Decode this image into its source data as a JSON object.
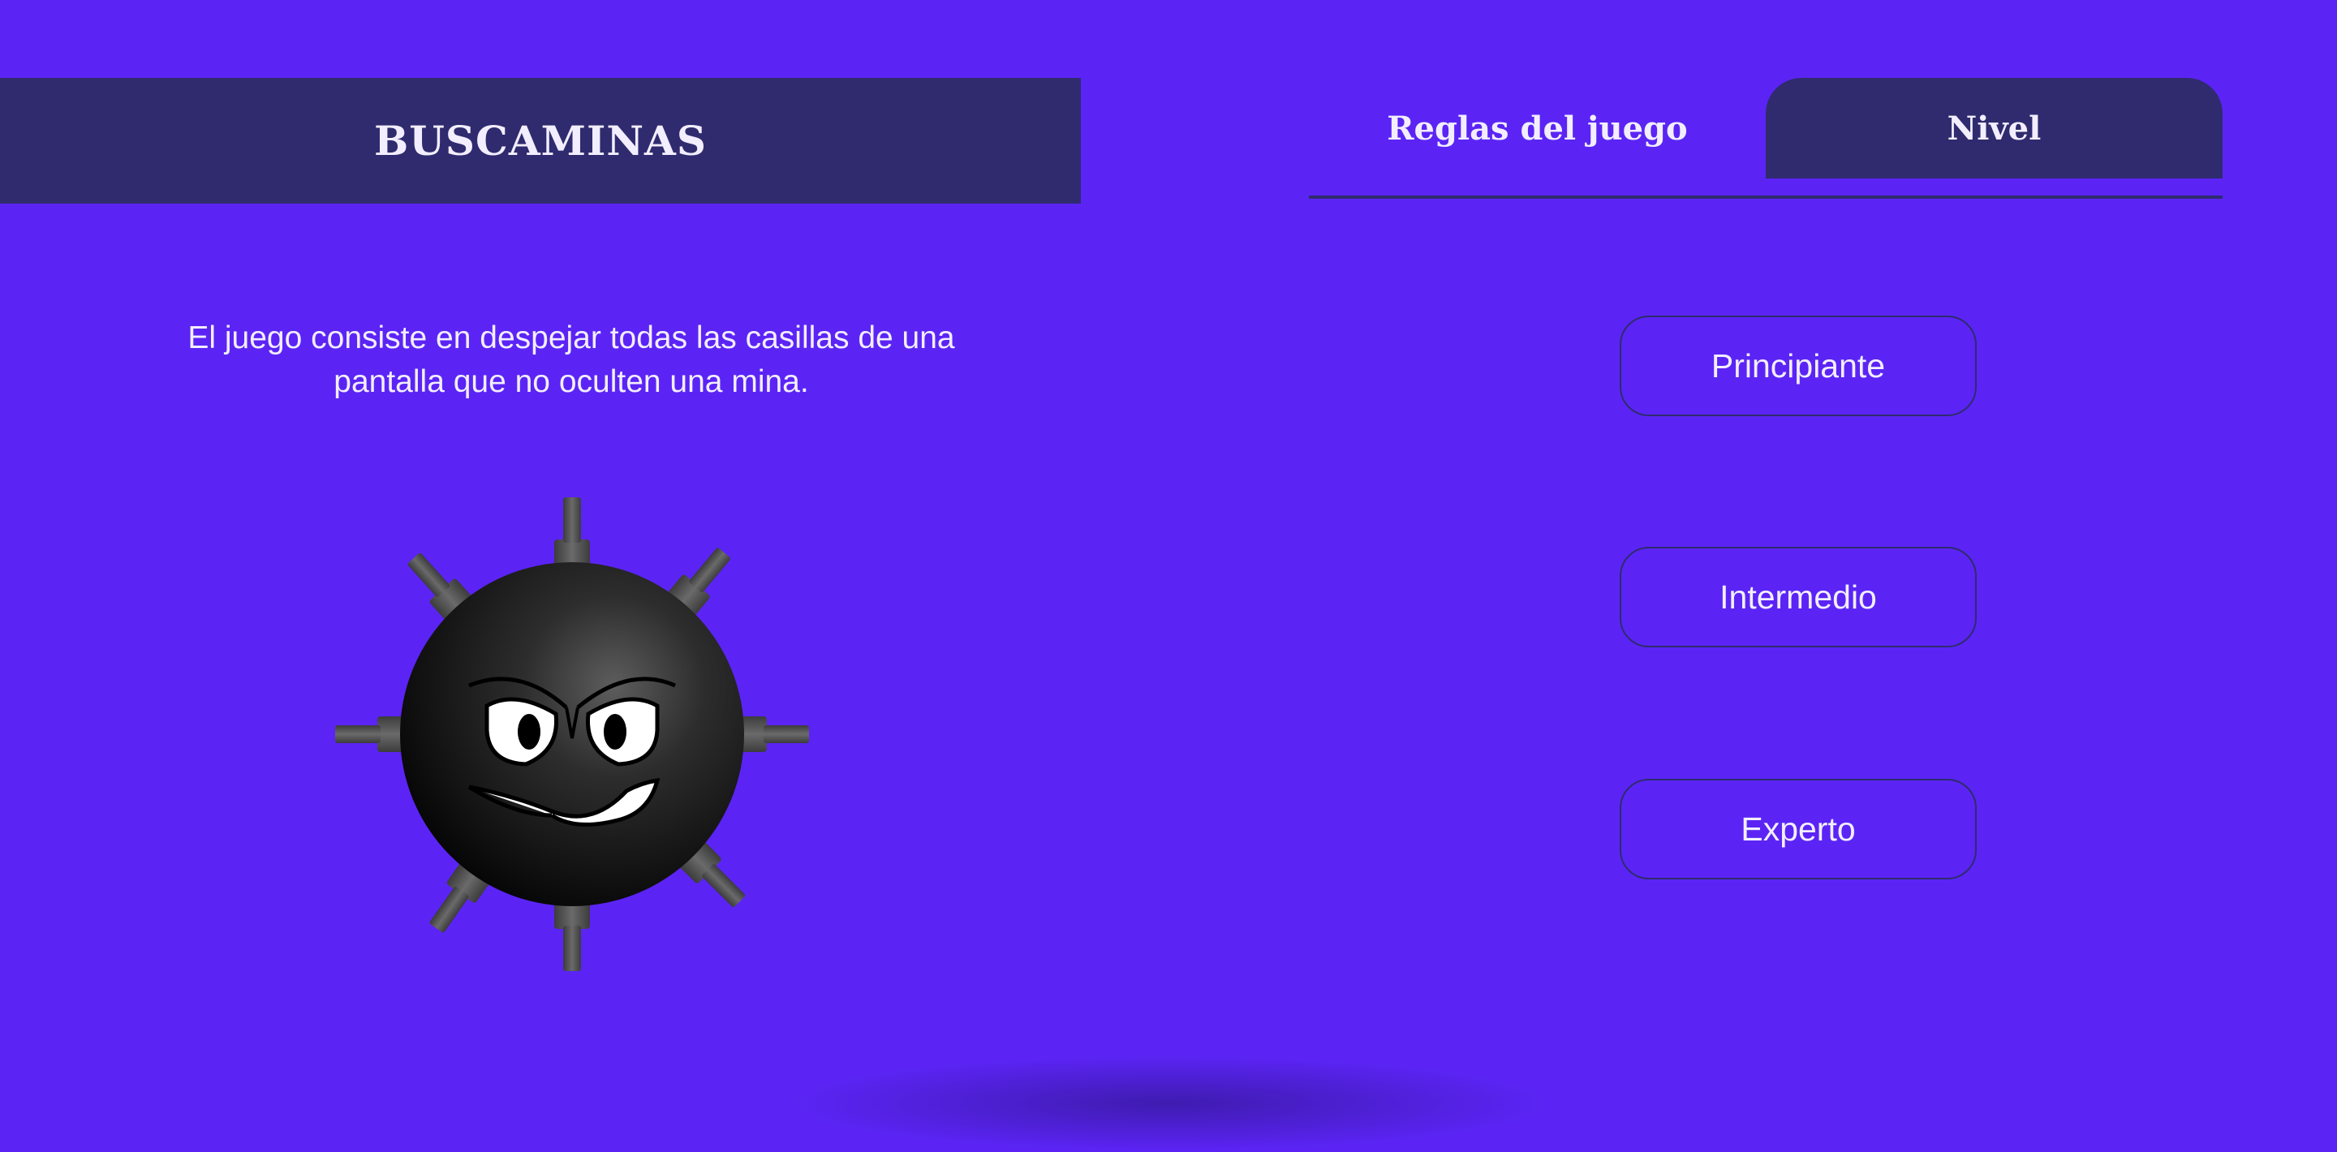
{
  "header": {
    "title": "BUSCAMINAS"
  },
  "tabs": [
    {
      "label": "Reglas del juego"
    },
    {
      "label": "Nivel"
    }
  ],
  "rules": {
    "description": "El juego consiste en despejar todas las casillas de una pantalla que no oculten una mina."
  },
  "levels": [
    {
      "label": "Principiante"
    },
    {
      "label": "Intermedio"
    },
    {
      "label": "Experto"
    }
  ],
  "illustration": {
    "icon": "mine-icon"
  },
  "colors": {
    "background": "#5b24f5",
    "panel": "#2f2b6e",
    "text": "#f2eeff"
  }
}
